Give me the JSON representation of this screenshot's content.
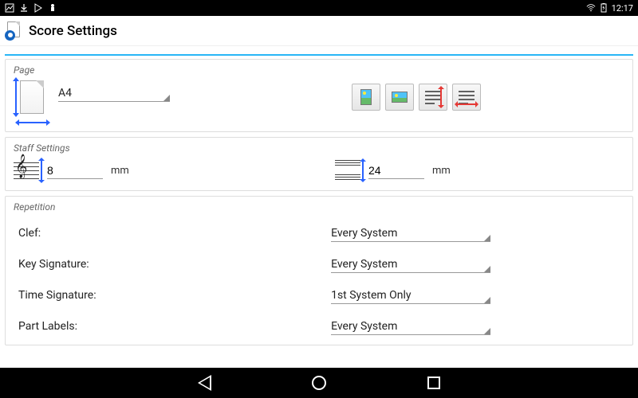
{
  "status": {
    "time": "12:17"
  },
  "header": {
    "title": "Score Settings"
  },
  "page": {
    "section_label": "Page",
    "size_value": "A4"
  },
  "staff": {
    "section_label": "Staff Settings",
    "staff_height_value": "8",
    "staff_height_unit": "mm",
    "system_spacing_value": "24",
    "system_spacing_unit": "mm"
  },
  "repetition": {
    "section_label": "Repetition",
    "rows": [
      {
        "label": "Clef:",
        "value": "Every System"
      },
      {
        "label": "Key Signature:",
        "value": "Every System"
      },
      {
        "label": "Time Signature:",
        "value": "1st System Only"
      },
      {
        "label": "Part Labels:",
        "value": "Every System"
      }
    ]
  }
}
